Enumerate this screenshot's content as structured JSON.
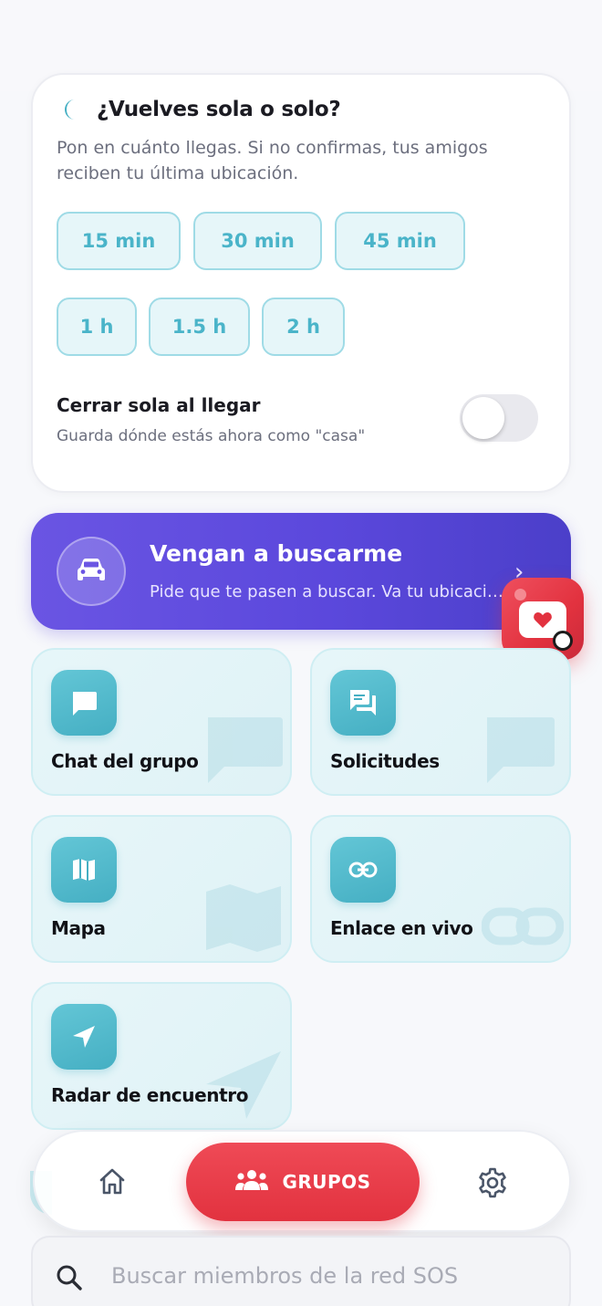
{
  "return_card": {
    "title": "¿Vuelves sola o solo?",
    "description": "Pon en cuánto llegas. Si no confirmas, tus amigos reciben tu última ubicación.",
    "durations": [
      "15 min",
      "30 min",
      "45 min",
      "1 h",
      "1.5 h",
      "2 h"
    ],
    "close_home": {
      "title": "Cerrar sola al llegar",
      "subtitle": "Guarda dónde estás ahora como \"casa\"",
      "enabled": false
    },
    "icon": "moon-icon"
  },
  "pickup_banner": {
    "title": "Vengan a buscarme",
    "subtitle": "Pide que te pasen a buscar. Va tu ubicación en vivo",
    "icon": "car-icon"
  },
  "features": [
    {
      "label": "Chat del grupo",
      "icon": "chat-icon"
    },
    {
      "label": "Solicitudes",
      "icon": "requests-icon"
    },
    {
      "label": "Mapa",
      "icon": "map-icon"
    },
    {
      "label": "Enlace en vivo",
      "icon": "link-icon"
    },
    {
      "label": "Radar de encuentro",
      "icon": "navigation-icon"
    }
  ],
  "bottom_nav": {
    "home_icon": "home-icon",
    "groups_label": "GRUPOS",
    "settings_icon": "gear-icon"
  },
  "search": {
    "placeholder": "Buscar miembros de la red SOS",
    "value": ""
  },
  "colors": {
    "accent_teal": "#4ab4c9",
    "pickup_purple": "#5b48dc",
    "sos_red": "#e2323f",
    "text_dark": "#1b1b22",
    "text_muted": "#6c6f7e"
  }
}
